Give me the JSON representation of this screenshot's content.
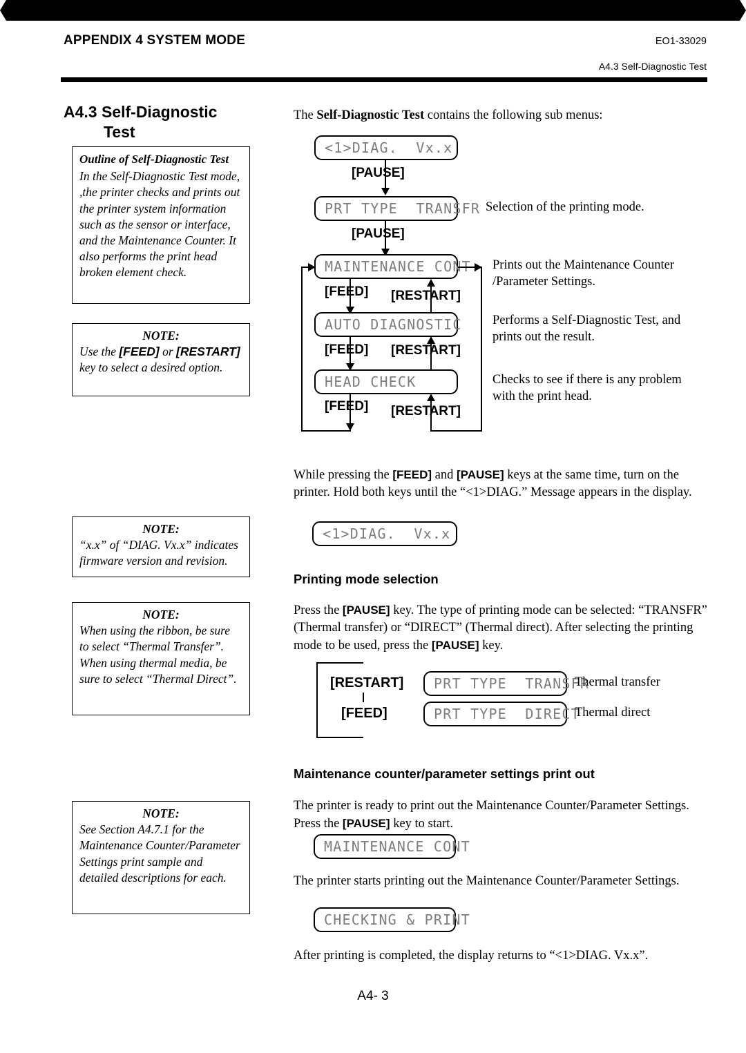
{
  "header": {
    "left_title": "APPENDIX 4 SYSTEM MODE",
    "doc_code": "EO1-33029",
    "section_ref": "A4.3 Self-Diagnostic Test"
  },
  "section": {
    "number": "A4.3",
    "title_line1": "Self-Diagnostic",
    "title_line2": "Test"
  },
  "outline_box": {
    "title": "Outline of Self-Diagnostic Test",
    "body": "In the Self-Diagnostic Test mode, ,the printer checks and prints out  the printer system information such as the sensor or interface, and the Maintenance Counter.  It also performs the print head broken element check."
  },
  "note_feed": {
    "title": "NOTE:",
    "body_pre": "Use the ",
    "key1": "[FEED]",
    "body_mid": " or ",
    "key2": "[RESTART]",
    "body_post": " key to select a desired option."
  },
  "note_diag": {
    "title": "NOTE:",
    "body": "“x.x” of “DIAG.  Vx.x” indicates firmware version and revision."
  },
  "note_ribbon": {
    "title": "NOTE:",
    "body": "When using the ribbon, be sure to select “Thermal Transfer”. When using thermal media, be sure to select “Thermal Direct”."
  },
  "note_section": {
    "title": "NOTE:",
    "body": "See Section A4.7.1 for the Maintenance Counter/Parameter Settings print sample and detailed descriptions for each."
  },
  "intro": {
    "pre": "The ",
    "bold": "Self-Diagnostic Test",
    "post": " contains the following sub menus:"
  },
  "flow": {
    "boxes": {
      "diag": "<1>DIAG.  Vx.x",
      "prt_type": "PRT TYPE  TRANSFR",
      "maintenance": "MAINTENANCE CONT.",
      "auto_diag": "AUTO DIAGNOSTIC",
      "head_check": "HEAD CHECK"
    },
    "keys": {
      "pause": "[PAUSE]",
      "feed": "[FEED]",
      "restart": "[RESTART]"
    },
    "descriptions": {
      "prt_type": "Selection of the printing mode.",
      "maintenance": "Prints out the Maintenance Counter /Parameter Settings.",
      "auto_diag": "Performs a Self-Diagnostic Test, and prints out the result.",
      "head_check": "Checks to see if there is any problem with the print head."
    }
  },
  "startup": {
    "p1_a": "While pressing the ",
    "p1_key1": "[FEED]",
    "p1_b": " and ",
    "p1_key2": "[PAUSE]",
    "p1_c": " keys at the same time, turn on the printer.  Hold both keys until the “<1>DIAG.” Message appears in the display.",
    "lcd": "<1>DIAG.  Vx.x"
  },
  "printing_mode": {
    "heading": "Printing mode selection",
    "p1_a": "Press the ",
    "p1_key1": "[PAUSE]",
    "p1_b": " key.  The type of printing mode can  be selected: “TRANSFR” (Thermal transfer) or “DIRECT” (Thermal direct). After selecting the printing mode to be used, press the ",
    "p1_key2": "[PAUSE]",
    "p1_c": " key.",
    "restart_label": "[RESTART]",
    "feed_label": "[FEED]",
    "lcd_transfer": "PRT TYPE  TRANSFR",
    "lcd_direct": "PRT TYPE  DIRECT",
    "desc_transfer": "Thermal transfer",
    "desc_direct": "Thermal direct"
  },
  "maintenance_printout": {
    "heading": "Maintenance counter/parameter settings print out",
    "p1_a": "The printer is ready to print out the Maintenance Counter/Parameter Settings.  Press the ",
    "p1_key": "[PAUSE]",
    "p1_b": " key to start.",
    "lcd1": "MAINTENANCE CONT",
    "p2": "The printer starts printing out the Maintenance Counter/Parameter Settings.",
    "lcd2": "CHECKING & PRINT",
    "p3": "After printing is completed, the display returns to “<1>DIAG.  Vx.x”."
  },
  "footer": {
    "page_number": "A4- 3"
  }
}
